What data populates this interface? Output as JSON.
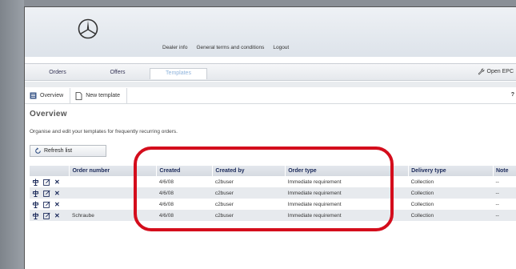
{
  "header": {
    "links": [
      "Dealer info",
      "General terms and conditions",
      "Logout"
    ]
  },
  "tabs": [
    {
      "label": "Orders",
      "selected": false
    },
    {
      "label": "Offers",
      "selected": false
    },
    {
      "label": "Templates",
      "selected": true
    }
  ],
  "open_epc": "Open EPC",
  "toolbar": {
    "overview": "Overview",
    "new_template": "New template",
    "help": "?"
  },
  "page": {
    "title": "Overview",
    "subtitle": "Organise and edit your templates for frequently recurring orders."
  },
  "refresh_label": "Refresh list",
  "table": {
    "headers": [
      "Order number",
      "Created",
      "Created by",
      "Order type",
      "Delivery type",
      "Note"
    ],
    "rows": [
      {
        "order_number": "",
        "created": "4/6/08",
        "created_by": "c2buser",
        "order_type": "Immediate requirement",
        "delivery_type": "Collection",
        "note": "--"
      },
      {
        "order_number": "",
        "created": "4/6/08",
        "created_by": "c2buser",
        "order_type": "Immediate requirement",
        "delivery_type": "Collection",
        "note": "--"
      },
      {
        "order_number": "",
        "created": "4/6/08",
        "created_by": "c2buser",
        "order_type": "Immediate requirement",
        "delivery_type": "Collection",
        "note": "--"
      },
      {
        "order_number": "Schraube",
        "created": "4/6/08",
        "created_by": "c2buser",
        "order_type": "Immediate requirement",
        "delivery_type": "Collection",
        "note": "--"
      }
    ]
  },
  "colors": {
    "highlight": "#d40d1c",
    "header_text": "#1b2a5a",
    "selected_tab": "#8fb4dc"
  }
}
